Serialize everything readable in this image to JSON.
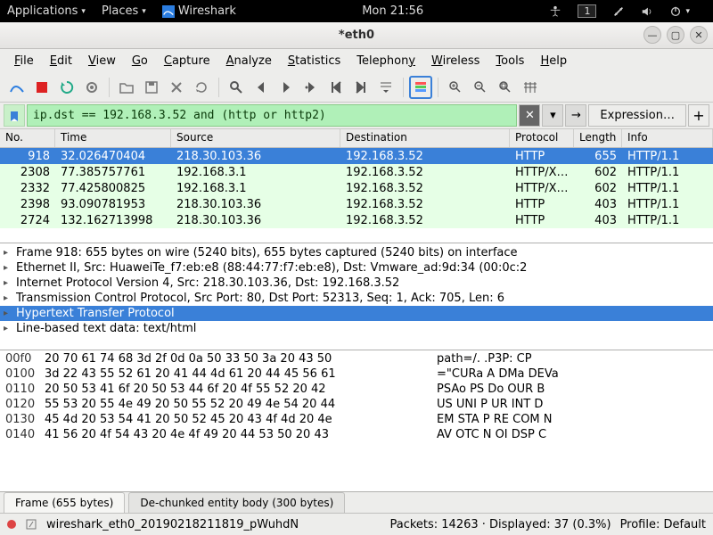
{
  "gnome": {
    "apps": "Applications",
    "places": "Places",
    "app": "Wireshark",
    "time": "Mon 21:56",
    "workspace": "1"
  },
  "window": {
    "title": "*eth0"
  },
  "menus": [
    "File",
    "Edit",
    "View",
    "Go",
    "Capture",
    "Analyze",
    "Statistics",
    "Telephony",
    "Wireless",
    "Tools",
    "Help"
  ],
  "filter": {
    "value": "ip.dst == 192.168.3.52 and (http or http2)",
    "expression": "Expression…"
  },
  "columns": [
    "No.",
    "Time",
    "Source",
    "Destination",
    "Protocol",
    "Length",
    "Info"
  ],
  "packets": [
    {
      "no": "918",
      "time": "32.026470404",
      "src": "218.30.103.36",
      "dst": "192.168.3.52",
      "proto": "HTTP",
      "len": "655",
      "info": "HTTP/1.1",
      "sel": true
    },
    {
      "no": "2308",
      "time": "77.385757761",
      "src": "192.168.3.1",
      "dst": "192.168.3.52",
      "proto": "HTTP/X…",
      "len": "602",
      "info": "HTTP/1.1"
    },
    {
      "no": "2332",
      "time": "77.425800825",
      "src": "192.168.3.1",
      "dst": "192.168.3.52",
      "proto": "HTTP/X…",
      "len": "602",
      "info": "HTTP/1.1"
    },
    {
      "no": "2398",
      "time": "93.090781953",
      "src": "218.30.103.36",
      "dst": "192.168.3.52",
      "proto": "HTTP",
      "len": "403",
      "info": "HTTP/1.1"
    },
    {
      "no": "2724",
      "time": "132.162713998",
      "src": "218.30.103.36",
      "dst": "192.168.3.52",
      "proto": "HTTP",
      "len": "403",
      "info": "HTTP/1.1"
    }
  ],
  "details": [
    {
      "t": "Frame 918: 655 bytes on wire (5240 bits), 655 bytes captured (5240 bits) on interface"
    },
    {
      "t": "Ethernet II, Src: HuaweiTe_f7:eb:e8 (88:44:77:f7:eb:e8), Dst: Vmware_ad:9d:34 (00:0c:2"
    },
    {
      "t": "Internet Protocol Version 4, Src: 218.30.103.36, Dst: 192.168.3.52"
    },
    {
      "t": "Transmission Control Protocol, Src Port: 80, Dst Port: 52313, Seq: 1, Ack: 705, Len: 6"
    },
    {
      "t": "Hypertext Transfer Protocol",
      "sel": true
    },
    {
      "t": "Line-based text data: text/html"
    }
  ],
  "hex": [
    {
      "off": "00f0",
      "b": "20 70 61 74 68 3d 2f 0d  0a 50 33 50 3a 20 43 50",
      "a": " path=/. .P3P: CP"
    },
    {
      "off": "0100",
      "b": "3d 22 43 55 52 61 20 41  44 4d 61 20 44 45 56 61",
      "a": "=\"CURa A DMa DEVa"
    },
    {
      "off": "0110",
      "b": "20 50 53 41 6f 20 50 53  44 6f 20 4f 55 52 20 42",
      "a": " PSAo PS Do OUR B"
    },
    {
      "off": "0120",
      "b": "55 53 20 55 4e 49 20 50  55 52 20 49 4e 54 20 44",
      "a": "US UNI P UR INT D"
    },
    {
      "off": "0130",
      "b": "45 4d 20 53 54 41 20 50  52 45 20 43 4f 4d 20 4e",
      "a": "EM STA P RE COM N"
    },
    {
      "off": "0140",
      "b": "41 56 20 4f 54 43 20 4e  4f 49 20 44 53 50 20 43",
      "a": "AV OTC N OI DSP C"
    }
  ],
  "hextabs": [
    "Frame (655 bytes)",
    "De-chunked entity body (300 bytes)"
  ],
  "status": {
    "file": "wireshark_eth0_20190218211819_pWuhdN",
    "packets": "Packets: 14263 · Displayed: 37 (0.3%)",
    "profile": "Profile: Default"
  }
}
